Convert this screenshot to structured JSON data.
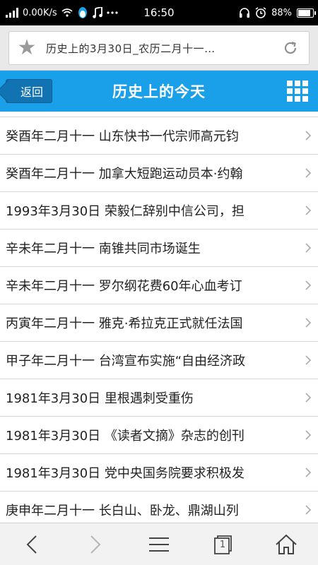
{
  "status_bar": {
    "network_speed": "0.00K/s",
    "time": "16:50",
    "battery_percent": "88%",
    "battery_level": 0.88
  },
  "address_bar": {
    "page_title": "历史上的3月30日_农历二月十一…"
  },
  "header": {
    "back_label": "返回",
    "title": "历史上的今天"
  },
  "list": {
    "items": [
      "癸酉年二月十一 山东快书一代宗师高元钧",
      "癸酉年二月十一 加拿大短跑运动员本·约翰",
      "1993年3月30日 荣毅仁辞别中信公司，担",
      "辛未年二月十一 南锥共同市场诞生",
      "辛未年二月十一 罗尔纲花费60年心血考订",
      "丙寅年二月十一 雅克·希拉克正式就任法国",
      "甲子年二月十一 台湾宣布实施“自由经济政",
      "1981年3月30日 里根遇刺受重伤",
      "1981年3月30日 《读者文摘》杂志的创刊",
      "1981年3月30日 党中央国务院要求积极发",
      "庚申年二月十一 长白山、卧龙、鼎湖山列"
    ]
  },
  "bottom_bar": {
    "tab_count": "1"
  },
  "colors": {
    "header_bg": "#1aa0e8",
    "back_button_bg": "#1273b3",
    "status_bar_bg": "#000000"
  }
}
